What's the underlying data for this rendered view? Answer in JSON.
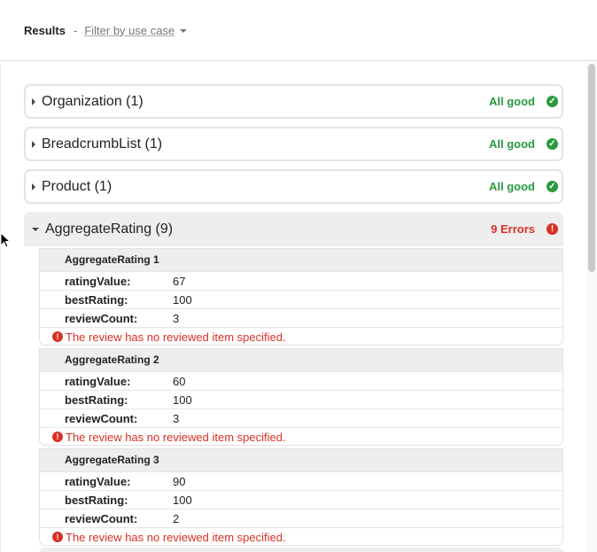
{
  "header": {
    "title": "Results",
    "separator": "-",
    "filter_label": "Filter by use case"
  },
  "results": [
    {
      "label": "Organization (1)",
      "status": "All good",
      "state": "good"
    },
    {
      "label": "BreadcrumbList (1)",
      "status": "All good",
      "state": "good"
    },
    {
      "label": "Product (1)",
      "status": "All good",
      "state": "good"
    },
    {
      "label": "AggregateRating (9)",
      "status": "9 Errors",
      "state": "error"
    }
  ],
  "aggregate_items": [
    {
      "title": "AggregateRating 1",
      "props": [
        {
          "key": "ratingValue:",
          "value": "67"
        },
        {
          "key": "bestRating:",
          "value": "100"
        },
        {
          "key": "reviewCount:",
          "value": "3"
        }
      ],
      "error": "The review has no reviewed item specified."
    },
    {
      "title": "AggregateRating 2",
      "props": [
        {
          "key": "ratingValue:",
          "value": "60"
        },
        {
          "key": "bestRating:",
          "value": "100"
        },
        {
          "key": "reviewCount:",
          "value": "3"
        }
      ],
      "error": "The review has no reviewed item specified."
    },
    {
      "title": "AggregateRating 3",
      "props": [
        {
          "key": "ratingValue:",
          "value": "90"
        },
        {
          "key": "bestRating:",
          "value": "100"
        },
        {
          "key": "reviewCount:",
          "value": "2"
        }
      ],
      "error": "The review has no reviewed item specified."
    }
  ],
  "icons": {
    "good": "check-circle-icon",
    "error": "exclamation-circle-icon"
  },
  "colors": {
    "good": "#2a9a3f",
    "error": "#d93025"
  }
}
